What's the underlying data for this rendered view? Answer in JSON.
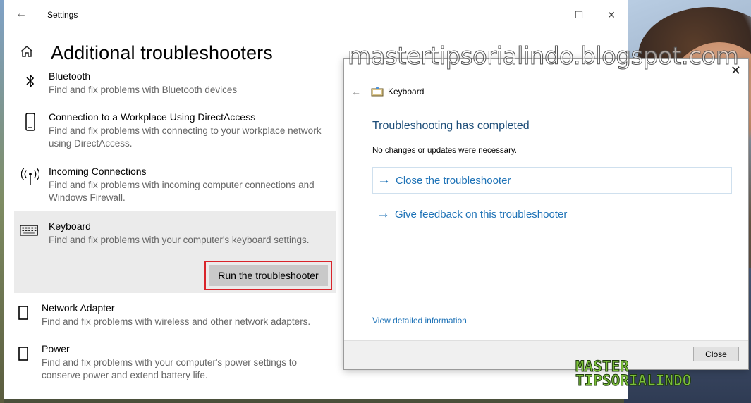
{
  "settings": {
    "window_title": "Settings",
    "page_title": "Additional troubleshooters",
    "items": [
      {
        "title": "Bluetooth",
        "desc": "Find and fix problems with Bluetooth devices",
        "icon": "bluetooth-icon"
      },
      {
        "title": "Connection to a Workplace Using DirectAccess",
        "desc": "Find and fix problems with connecting to your workplace network using DirectAccess.",
        "icon": "phone-device-icon"
      },
      {
        "title": "Incoming Connections",
        "desc": "Find and fix problems with incoming computer connections and Windows Firewall.",
        "icon": "antenna-icon"
      },
      {
        "title": "Keyboard",
        "desc": "Find and fix problems with your computer's keyboard settings.",
        "icon": "keyboard-icon"
      },
      {
        "title": "Network Adapter",
        "desc": "Find and fix problems with wireless and other network adapters.",
        "icon": "network-adapter-icon"
      },
      {
        "title": "Power",
        "desc": "Find and fix problems with your computer's power settings to conserve power and extend battery life.",
        "icon": "power-icon"
      }
    ],
    "run_button_label": "Run the troubleshooter"
  },
  "dialog": {
    "app_name": "Keyboard",
    "heading": "Troubleshooting has completed",
    "message": "No changes or updates were necessary.",
    "options": [
      {
        "label": "Close the troubleshooter"
      },
      {
        "label": "Give feedback on this troubleshooter"
      }
    ],
    "detail_link": "View detailed information",
    "close_button": "Close"
  },
  "watermark": {
    "url": "mastertipsorialindo.blogspot.com",
    "logo_line1": "MASTER",
    "logo_line2": "TIPSORIALINDO"
  },
  "colors": {
    "link_blue": "#1f73b7",
    "heading_blue": "#1e4e79",
    "highlight_red": "#d9242a",
    "selected_bg": "#ebebeb"
  }
}
